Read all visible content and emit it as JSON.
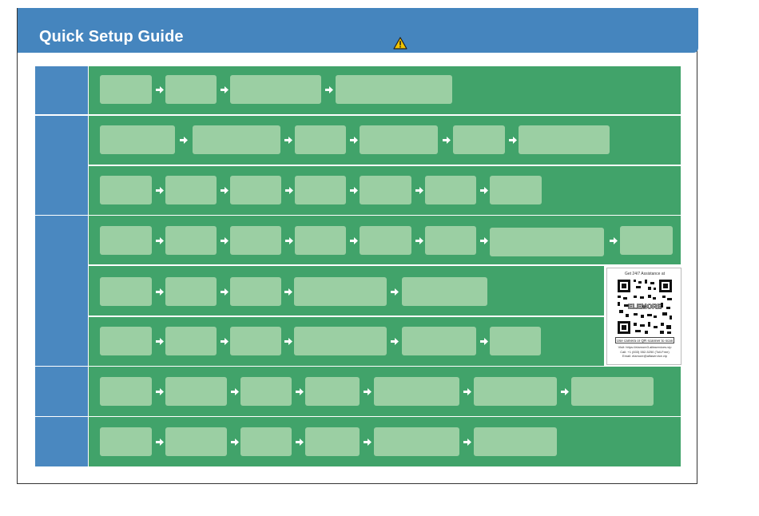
{
  "header": {
    "title": "Quick Setup Guide",
    "warning_icon": "warning-triangle-icon"
  },
  "colors": {
    "header_blue": "#4585be",
    "section_blue": "#4a88c0",
    "row_green": "#41a36a",
    "step_box_green": "#9bcfa3"
  },
  "qr_card": {
    "heading": "Get 24/7 Assistance at",
    "qr_logo_text": "ELEMORE",
    "caption": "Use camera or QR scanner to scan",
    "visit": "Visit: https://elamore3.alfaservices.vip",
    "call": "Call: +1 (833) 552-5250 (Toll-Free)",
    "email": "Email: elamore@alfaservice.vip"
  }
}
